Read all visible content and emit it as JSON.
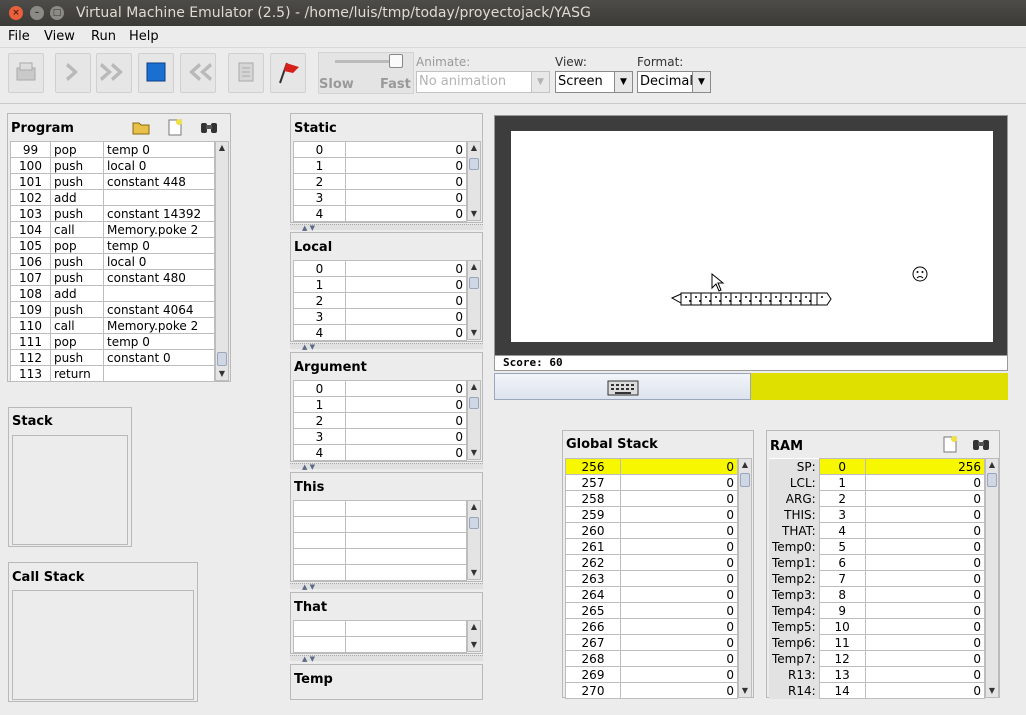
{
  "window": {
    "title": "Virtual Machine Emulator (2.5) - /home/luis/tmp/today/proyectojack/YASG",
    "close": "×",
    "minimize": "–",
    "maximize": "□"
  },
  "menu": [
    "File",
    "View",
    "Run",
    "Help"
  ],
  "toolbar": {
    "speed_slow": "Slow",
    "speed_fast": "Fast",
    "animate_label": "Animate:",
    "animate_value": "No animation",
    "view_label": "View:",
    "view_value": "Screen",
    "format_label": "Format:",
    "format_value": "Decimal",
    "icons": [
      "load-program-icon",
      "single-step-icon",
      "fast-forward-icon",
      "stop-icon",
      "rewind-icon",
      "script-icon",
      "breakpoints-flag-icon"
    ]
  },
  "program": {
    "title": "Program",
    "rows": [
      [
        "99",
        "pop",
        "temp 0"
      ],
      [
        "100",
        "push",
        "local 0"
      ],
      [
        "101",
        "push",
        "constant 448"
      ],
      [
        "102",
        "add",
        ""
      ],
      [
        "103",
        "push",
        "constant 14392"
      ],
      [
        "104",
        "call",
        "Memory.poke 2"
      ],
      [
        "105",
        "pop",
        "temp 0"
      ],
      [
        "106",
        "push",
        "local 0"
      ],
      [
        "107",
        "push",
        "constant 480"
      ],
      [
        "108",
        "add",
        ""
      ],
      [
        "109",
        "push",
        "constant 4064"
      ],
      [
        "110",
        "call",
        "Memory.poke 2"
      ],
      [
        "111",
        "pop",
        "temp 0"
      ],
      [
        "112",
        "push",
        "constant 0"
      ],
      [
        "113",
        "return",
        ""
      ]
    ]
  },
  "stack": {
    "title": "Stack"
  },
  "callstack": {
    "title": "Call Stack"
  },
  "segments": {
    "static": {
      "title": "Static",
      "rows": [
        [
          "0",
          "0"
        ],
        [
          "1",
          "0"
        ],
        [
          "2",
          "0"
        ],
        [
          "3",
          "0"
        ],
        [
          "4",
          "0"
        ]
      ]
    },
    "local": {
      "title": "Local",
      "rows": [
        [
          "0",
          "0"
        ],
        [
          "1",
          "0"
        ],
        [
          "2",
          "0"
        ],
        [
          "3",
          "0"
        ],
        [
          "4",
          "0"
        ]
      ]
    },
    "argument": {
      "title": "Argument",
      "rows": [
        [
          "0",
          "0"
        ],
        [
          "1",
          "0"
        ],
        [
          "2",
          "0"
        ],
        [
          "3",
          "0"
        ],
        [
          "4",
          "0"
        ]
      ]
    },
    "this": {
      "title": "This"
    },
    "that": {
      "title": "That"
    },
    "temp": {
      "title": "Temp"
    }
  },
  "screen": {
    "score": "Score: 60",
    "bg": "#3d3d3d",
    "keyboard_fill": "#e0e000"
  },
  "global_stack": {
    "title": "Global Stack",
    "rows": [
      [
        "256",
        "0"
      ],
      [
        "257",
        "0"
      ],
      [
        "258",
        "0"
      ],
      [
        "259",
        "0"
      ],
      [
        "260",
        "0"
      ],
      [
        "261",
        "0"
      ],
      [
        "262",
        "0"
      ],
      [
        "263",
        "0"
      ],
      [
        "264",
        "0"
      ],
      [
        "265",
        "0"
      ],
      [
        "266",
        "0"
      ],
      [
        "267",
        "0"
      ],
      [
        "268",
        "0"
      ],
      [
        "269",
        "0"
      ],
      [
        "270",
        "0"
      ]
    ]
  },
  "ram": {
    "title": "RAM",
    "rows": [
      [
        "SP:",
        "0",
        "256"
      ],
      [
        "LCL:",
        "1",
        "0"
      ],
      [
        "ARG:",
        "2",
        "0"
      ],
      [
        "THIS:",
        "3",
        "0"
      ],
      [
        "THAT:",
        "4",
        "0"
      ],
      [
        "Temp0:",
        "5",
        "0"
      ],
      [
        "Temp1:",
        "6",
        "0"
      ],
      [
        "Temp2:",
        "7",
        "0"
      ],
      [
        "Temp3:",
        "8",
        "0"
      ],
      [
        "Temp4:",
        "9",
        "0"
      ],
      [
        "Temp5:",
        "10",
        "0"
      ],
      [
        "Temp6:",
        "11",
        "0"
      ],
      [
        "Temp7:",
        "12",
        "0"
      ],
      [
        "R13:",
        "13",
        "0"
      ],
      [
        "R14:",
        "14",
        "0"
      ]
    ]
  }
}
